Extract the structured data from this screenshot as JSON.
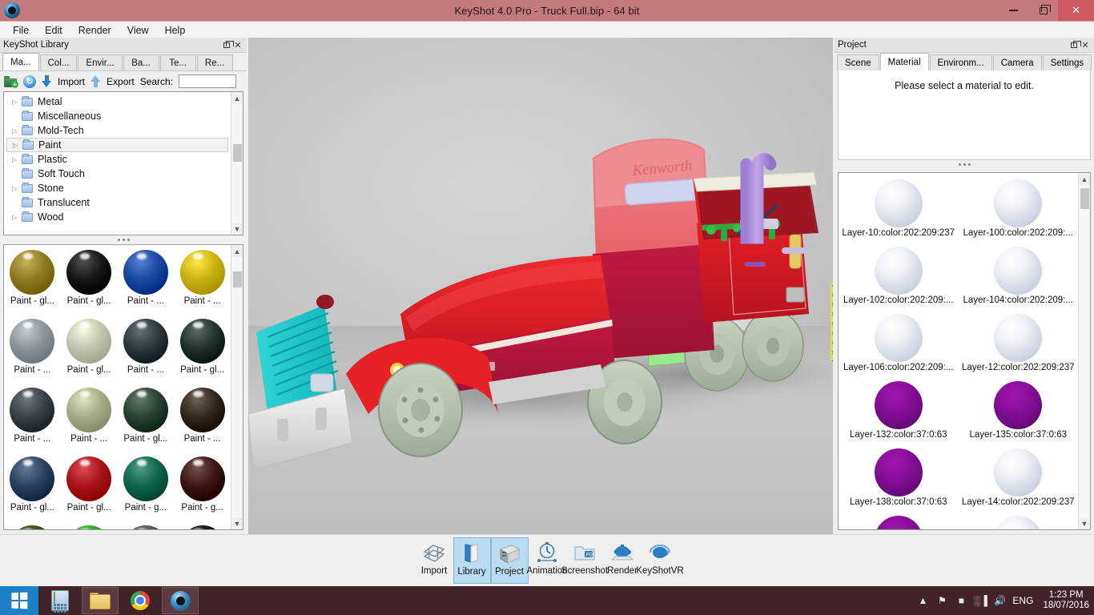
{
  "window": {
    "title": "KeyShot 4.0 Pro  - Truck Full.bip  - 64 bit",
    "app_icon": "keyshot-eye-icon",
    "minimize": "–",
    "maximize": "restore-icon",
    "close": "✕",
    "titlebar_color": "#c1797e"
  },
  "menubar": {
    "items": [
      {
        "label": "File"
      },
      {
        "label": "Edit"
      },
      {
        "label": "Render"
      },
      {
        "label": "View"
      },
      {
        "label": "Help"
      }
    ]
  },
  "library": {
    "title": "KeyShot Library",
    "float_icon": "restore-panel-icon",
    "close_icon": "✕",
    "tabs": [
      {
        "label": "Ma...",
        "active": true
      },
      {
        "label": "Col...",
        "active": false
      },
      {
        "label": "Envir...",
        "active": false
      },
      {
        "label": "Ba...",
        "active": false
      },
      {
        "label": "Te...",
        "active": false
      },
      {
        "label": "Re...",
        "active": false
      }
    ],
    "toolbar": {
      "add_folder_icon": "add-folder-icon",
      "refresh_icon": "refresh-icon",
      "import_label": "Import",
      "export_label": "Export",
      "search_label": "Search:",
      "search_value": "",
      "search_placeholder": ""
    },
    "tree": [
      {
        "label": "Metal",
        "expandable": true,
        "selected": false
      },
      {
        "label": "Miscellaneous",
        "expandable": false,
        "selected": false
      },
      {
        "label": "Mold-Tech",
        "expandable": true,
        "selected": false
      },
      {
        "label": "Paint",
        "expandable": true,
        "selected": true
      },
      {
        "label": "Plastic",
        "expandable": true,
        "selected": false
      },
      {
        "label": "Soft Touch",
        "expandable": false,
        "selected": false
      },
      {
        "label": "Stone",
        "expandable": true,
        "selected": false
      },
      {
        "label": "Translucent",
        "expandable": false,
        "selected": false
      },
      {
        "label": "Wood",
        "expandable": true,
        "selected": false
      }
    ],
    "materials": [
      {
        "label": "Paint - gl...",
        "color": "#8f7b22"
      },
      {
        "label": "Paint - gl...",
        "color": "#171717"
      },
      {
        "label": "Paint - ...",
        "color": "#1c48a0"
      },
      {
        "label": "Paint - ...",
        "color": "#c9b211"
      },
      {
        "label": "Paint - ...",
        "color": "#8d949c"
      },
      {
        "label": "Paint - gl...",
        "color": "#c3c4ad"
      },
      {
        "label": "Paint - ...",
        "color": "#2e3940"
      },
      {
        "label": "Paint - gl...",
        "color": "#22342b"
      },
      {
        "label": "Paint - ...",
        "color": "#3a4047"
      },
      {
        "label": "Paint - ...",
        "color": "#a8ac86"
      },
      {
        "label": "Paint - gl...",
        "color": "#2a4334"
      },
      {
        "label": "Paint - ...",
        "color": "#33291f"
      },
      {
        "label": "Paint - gl...",
        "color": "#2d4260"
      },
      {
        "label": "Paint - gl...",
        "color": "#a8141b"
      },
      {
        "label": "Paint - g...",
        "color": "#12644f"
      },
      {
        "label": "Paint - g...",
        "color": "#3d1616"
      },
      {
        "label": "",
        "color": "#2c4314"
      },
      {
        "label": "",
        "color": "#22a01c"
      },
      {
        "label": "",
        "color": "#4d4d4d"
      },
      {
        "label": "",
        "color": "#0c0c0c"
      }
    ]
  },
  "project": {
    "title": "Project",
    "float_icon": "restore-panel-icon",
    "close_icon": "✕",
    "tabs": [
      {
        "label": "Scene",
        "active": false
      },
      {
        "label": "Material",
        "active": true
      },
      {
        "label": "Environm...",
        "active": false
      },
      {
        "label": "Camera",
        "active": false
      },
      {
        "label": "Settings",
        "active": false
      }
    ],
    "empty_message": "Please select a material to edit.",
    "layers": [
      {
        "label": "Layer-10:color:202:209:237",
        "kind": "white"
      },
      {
        "label": "Layer-100:color:202:209:...",
        "kind": "white"
      },
      {
        "label": "Layer-102:color:202:209:...",
        "kind": "white"
      },
      {
        "label": "Layer-104:color:202:209:...",
        "kind": "white"
      },
      {
        "label": "Layer-106:color:202:209:...",
        "kind": "white"
      },
      {
        "label": "Layer-12:color:202:209:237",
        "kind": "white"
      },
      {
        "label": "Layer-132:color:37:0:63",
        "kind": "purple"
      },
      {
        "label": "Layer-135:color:37:0:63",
        "kind": "purple"
      },
      {
        "label": "Layer-138:color:37:0:63",
        "kind": "purple"
      },
      {
        "label": "Layer-14:color:202:209:237",
        "kind": "white"
      },
      {
        "label": "",
        "kind": "purple"
      },
      {
        "label": "",
        "kind": "white"
      }
    ]
  },
  "dock": {
    "buttons": [
      {
        "label": "Import",
        "icon": "import-icon",
        "active": false
      },
      {
        "label": "Library",
        "icon": "library-icon",
        "active": true
      },
      {
        "label": "Project",
        "icon": "project-icon",
        "active": true
      },
      {
        "label": "Animation",
        "icon": "animation-icon",
        "active": false
      },
      {
        "label": "Screenshot",
        "icon": "screenshot-icon",
        "active": false
      },
      {
        "label": "Render",
        "icon": "render-icon",
        "active": false
      },
      {
        "label": "KeyShotVR",
        "icon": "keyshotvr-icon",
        "active": false
      }
    ]
  },
  "taskbar": {
    "start_icon": "windows-start-icon",
    "apps": [
      {
        "icon": "calculator-icon",
        "pinned": false
      },
      {
        "icon": "file-explorer-icon",
        "pinned": true
      },
      {
        "icon": "chrome-icon",
        "pinned": false
      },
      {
        "icon": "keyshot-icon",
        "pinned": true
      }
    ],
    "tray": {
      "chevron": "▲",
      "flag_icon": "flag-icon",
      "battery_icon": "battery-icon",
      "network_icon": "network-signal-icon",
      "volume_icon": "volume-icon",
      "language": "ENG",
      "time": "1:23 PM",
      "date": "18/07/2016"
    }
  },
  "viewport": {
    "scene_name": "Truck Full",
    "background": "#c4c4c4"
  }
}
